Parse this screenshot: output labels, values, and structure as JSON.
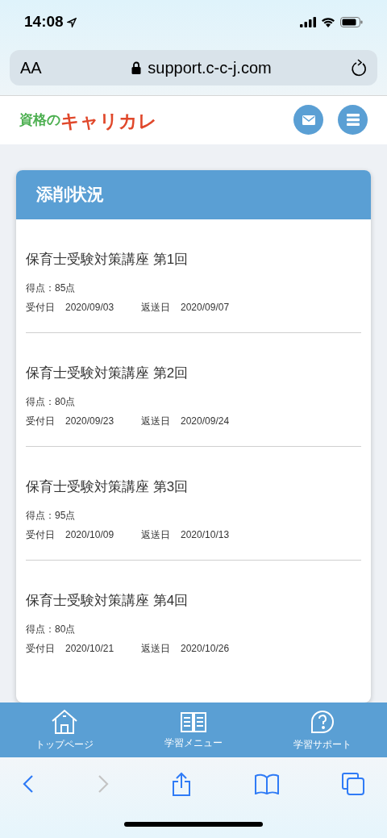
{
  "status_bar": {
    "time": "14:08"
  },
  "browser": {
    "text_size": "AA",
    "url": "support.c-c-j.com"
  },
  "logo": {
    "prefix": "資格の",
    "name": "キャリカレ"
  },
  "card": {
    "title": "添削状況",
    "items": [
      {
        "title": "保育士受験対策講座 第1回",
        "score": "得点：85点",
        "received_label": "受付日",
        "received": "2020/09/03",
        "returned_label": "返送日",
        "returned": "2020/09/07"
      },
      {
        "title": "保育士受験対策講座 第2回",
        "score": "得点：80点",
        "received_label": "受付日",
        "received": "2020/09/23",
        "returned_label": "返送日",
        "returned": "2020/09/24"
      },
      {
        "title": "保育士受験対策講座 第3回",
        "score": "得点：95点",
        "received_label": "受付日",
        "received": "2020/10/09",
        "returned_label": "返送日",
        "returned": "2020/10/13"
      },
      {
        "title": "保育士受験対策講座 第4回",
        "score": "得点：80点",
        "received_label": "受付日",
        "received": "2020/10/21",
        "returned_label": "返送日",
        "returned": "2020/10/26"
      }
    ]
  },
  "bottom_nav": [
    {
      "kind": "home",
      "label": "トップページ"
    },
    {
      "kind": "book",
      "label": "学習メニュー"
    },
    {
      "kind": "help",
      "label": "学習サポート"
    }
  ],
  "toolbar": {
    "forward_disabled": true
  }
}
